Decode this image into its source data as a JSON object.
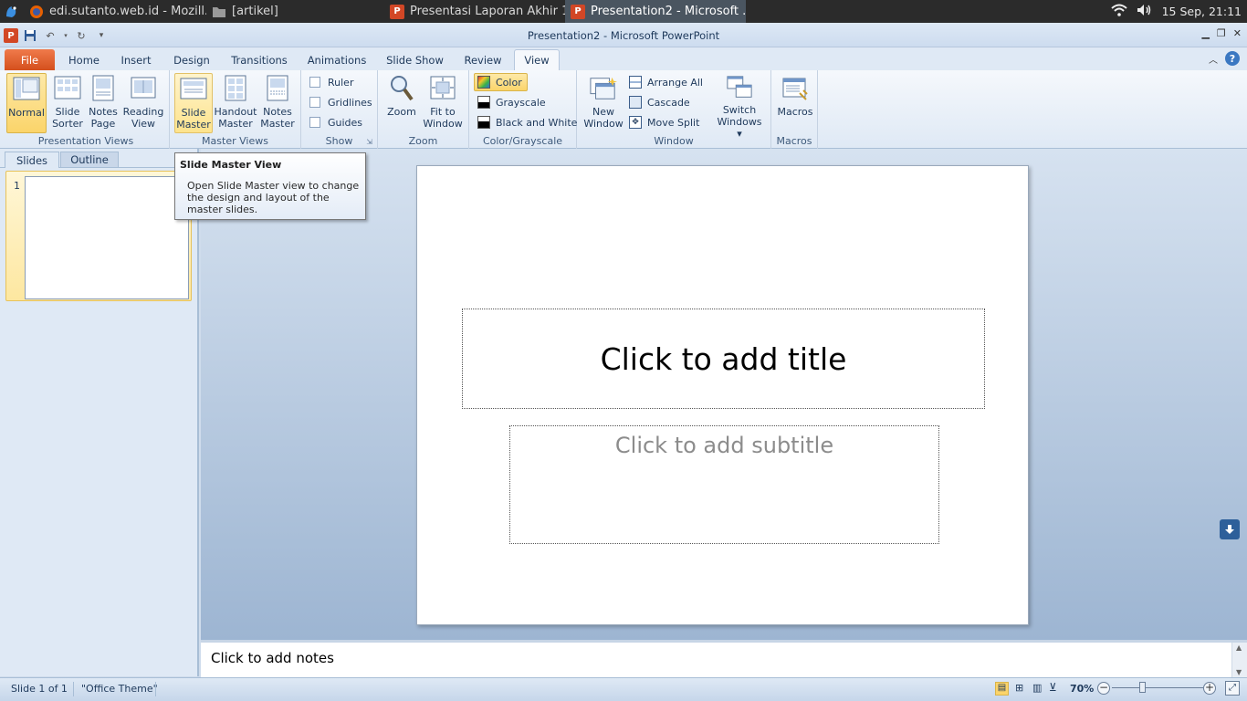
{
  "taskbar": {
    "tasks": [
      {
        "label": "edi.sutanto.web.id - Mozill...",
        "icon": "firefox-icon"
      },
      {
        "label": "[artikel]",
        "icon": "folder-icon"
      },
      {
        "label": "Presentasi Laporan Akhir 1...",
        "icon": "powerpoint-icon"
      },
      {
        "label": "Presentation2 - Microsoft ...",
        "icon": "powerpoint-icon"
      }
    ],
    "clock": "15 Sep, 21:11"
  },
  "window": {
    "title": "Presentation2  -  Microsoft PowerPoint"
  },
  "ribbon_tabs": [
    "File",
    "Home",
    "Insert",
    "Design",
    "Transitions",
    "Animations",
    "Slide Show",
    "Review",
    "View"
  ],
  "active_tab": "View",
  "groups": {
    "presentation_views": {
      "label": "Presentation Views",
      "normal": [
        "Normal",
        ""
      ],
      "slide_sorter": [
        "Slide",
        "Sorter"
      ],
      "notes_page": [
        "Notes",
        "Page"
      ],
      "reading_view": [
        "Reading",
        "View"
      ]
    },
    "master_views": {
      "label": "Master Views",
      "slide_master": [
        "Slide",
        "Master"
      ],
      "handout_master": [
        "Handout",
        "Master"
      ],
      "notes_master": [
        "Notes",
        "Master"
      ]
    },
    "show": {
      "label": "Show",
      "ruler": "Ruler",
      "gridlines": "Gridlines",
      "guides": "Guides"
    },
    "zoom": {
      "label": "Zoom",
      "zoom": [
        "Zoom",
        ""
      ],
      "fit": [
        "Fit to",
        "Window"
      ]
    },
    "color": {
      "label": "Color/Grayscale",
      "color": "Color",
      "grayscale": "Grayscale",
      "bw": "Black and White"
    },
    "window": {
      "label": "Window",
      "new_window": [
        "New",
        "Window"
      ],
      "arrange_all": "Arrange All",
      "cascade": "Cascade",
      "move_split": "Move Split",
      "switch": [
        "Switch",
        "Windows ▾"
      ]
    },
    "macros": {
      "label": "Macros",
      "macros": [
        "Macros",
        ""
      ]
    }
  },
  "tooltip": {
    "title": "Slide Master View",
    "body": "Open Slide Master view to change the design and layout of the master slides."
  },
  "left_panel": {
    "tabs": [
      "Slides",
      "Outline"
    ],
    "slide_number": "1"
  },
  "slide": {
    "title_placeholder": "Click to add title",
    "subtitle_placeholder": "Click to add subtitle"
  },
  "notes": {
    "placeholder": "Click to add notes"
  },
  "status": {
    "slide_info": "Slide 1 of 1",
    "theme": "\"Office Theme\"",
    "zoom": "70%"
  }
}
